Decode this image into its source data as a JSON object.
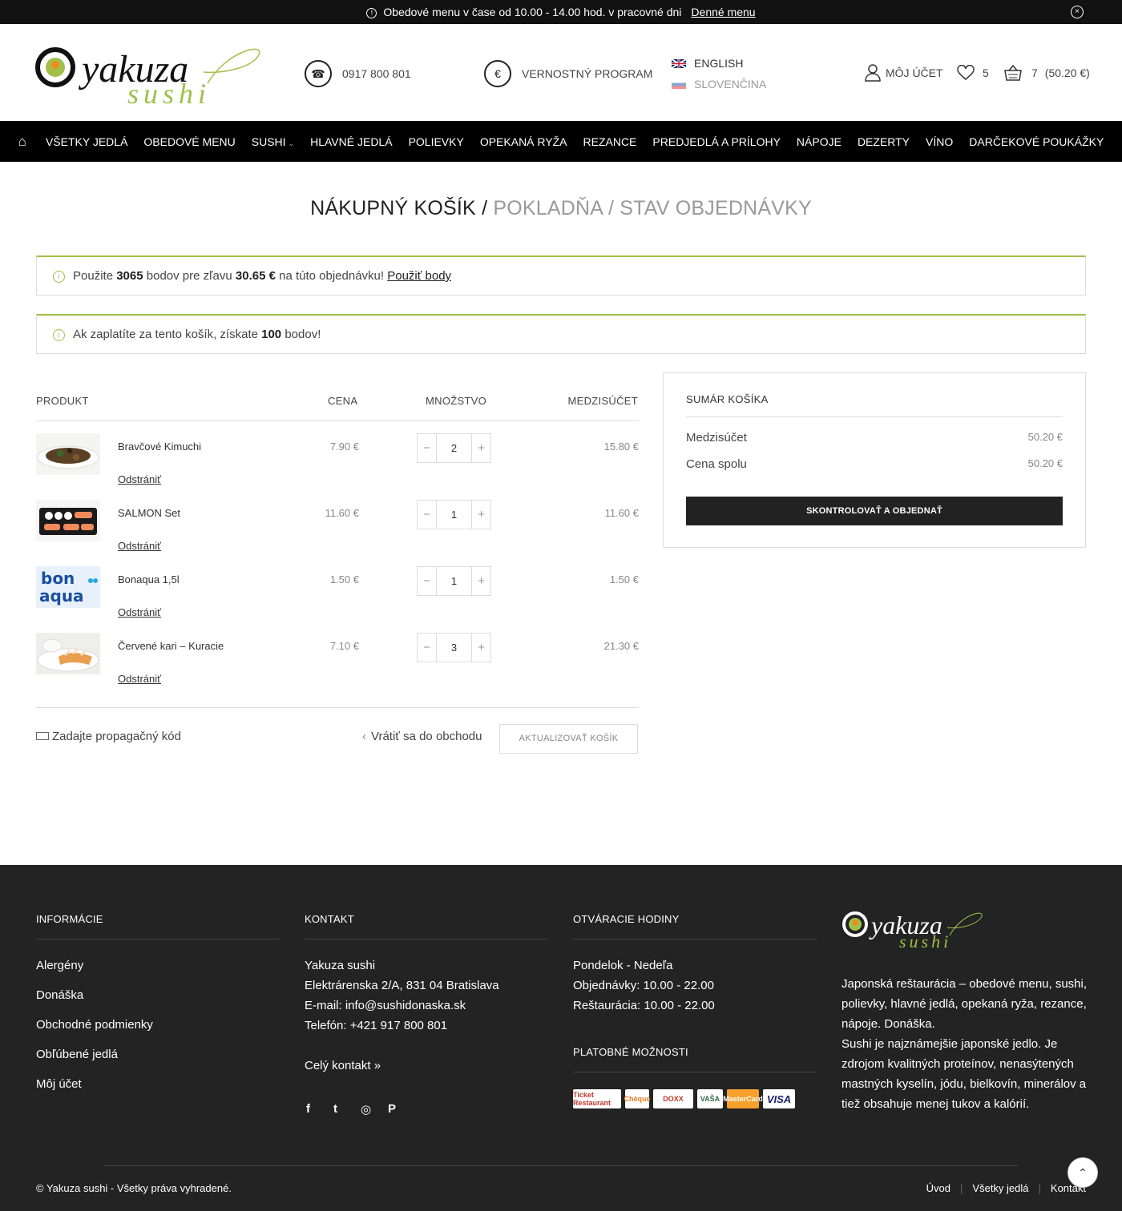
{
  "topbar": {
    "message": "Obedové menu v čase od 10.00 - 14.00 hod. v pracovné dni",
    "link": "Denné menu",
    "close": "×",
    "info_glyph": "!"
  },
  "header": {
    "logo_text": "yakuza",
    "logo_sub": "sushi",
    "phone": "0917 800 801",
    "loyalty": "VERNOSTNÝ PROGRAM",
    "languages": [
      "ENGLISH",
      "SLOVENČINA"
    ],
    "account": "MÔJ ÚČET",
    "wishlist_count": "5",
    "cart_count": "7",
    "cart_total": "(50.20 €)"
  },
  "nav": {
    "home_icon": "⌂",
    "items": [
      "VŠETKY JEDLÁ",
      "OBEDOVÉ MENU",
      "SUSHI",
      "HLAVNÉ JEDLÁ",
      "POLIEVKY",
      "OPEKANÁ RYŽA",
      "REZANCE",
      "PREDJEDLÁ A PRÍLOHY",
      "NÁPOJE",
      "DEZERTY",
      "VÍNO",
      "DARČEKOVÉ POUKÁŽKY"
    ]
  },
  "breadcrumb": {
    "current": "NÁKUPNÝ KOŠÍK",
    "sep": "/",
    "step2": "POKLADŇA",
    "step3": "STAV OBJEDNÁVKY"
  },
  "notice1": {
    "t1": "Použite",
    "points": "3065",
    "t2": "bodov pre zľavu",
    "amount": "30.65 €",
    "t3": "na túto objednávku!",
    "link": "Použiť body"
  },
  "notice2": {
    "t1": "Ak zaplatíte za tento košík, získate",
    "points": "100",
    "t2": "bodov!"
  },
  "cart": {
    "headers": {
      "product": "PRODUKT",
      "price": "CENA",
      "qty": "MNOŽSTVO",
      "subtotal": "MEDZISÚČET"
    },
    "remove_label": "Odstrániť",
    "rows": [
      {
        "name": "Bravčové Kimuchi",
        "price": "7.90 €",
        "qty": "2",
        "subtotal": "15.80 €"
      },
      {
        "name": "SALMON Set",
        "price": "11.60 €",
        "qty": "1",
        "subtotal": "11.60 €"
      },
      {
        "name": "Bonaqua 1,5l",
        "price": "1.50 €",
        "qty": "1",
        "subtotal": "1.50 €"
      },
      {
        "name": "Červené kari – Kuracie",
        "price": "7.10 €",
        "qty": "3",
        "subtotal": "21.30 €"
      }
    ],
    "promo": "Zadajte propagačný kód",
    "back": "Vrátiť sa do obchodu",
    "update": "AKTUALIZOVAŤ KOŠÍK",
    "bonaqua_label_1": "bon",
    "bonaqua_label_2": "aqua"
  },
  "summary": {
    "title": "SUMÁR KOŠÍKA",
    "subtotal_label": "Medzisúčet",
    "subtotal": "50.20 €",
    "total_label": "Cena spolu",
    "total": "50.20 €",
    "checkout": "SKONTROLOVAŤ A OBJEDNAŤ"
  },
  "footer": {
    "info_title": "INFORMÁCIE",
    "info_links": [
      "Alergény",
      "Donáška",
      "Obchodné podmienky",
      "Obľúbené jedlá",
      "Môj účet"
    ],
    "contact_title": "KONTAKT",
    "contact_lines": [
      "Yakuza sushi",
      "Elektrárenska 2/A, 831 04 Bratislava",
      "E-mail: info@sushidonaska.sk",
      "Telefón: +421 917 800 801"
    ],
    "contact_more": "Celý kontakt »",
    "hours_title": "OTVÁRACIE HODINY",
    "hours_lines": [
      "Pondelok - Nedeľa",
      "Objednávky: 10.00 - 22.00",
      "Reštaurácia: 10.00 - 22.00"
    ],
    "payment_title": "PLATOBNÉ MOŽNOSTI",
    "payments": [
      "Ticket Restaurant",
      "Chèque",
      "DOXX",
      "VAŠA",
      "MasterCard",
      "VISA"
    ],
    "about": "Japonská reštaurácia – obedové menu, sushi, polievky, hlavné jedlá, opekaná ryža, rezance, nápoje. Donáška.",
    "about2": "Sushi je najznámejšie japonské jedlo. Je zdrojom kvalitných proteínov, nenasýtených mastných kyselín, jódu, bielkovín, minerálov a tiež obsahuje menej tukov a kalórií.",
    "copyright": "© Yakuza sushi - Všetky práva vyhradené.",
    "bottom_links": [
      "Úvod",
      "Všetky jedlá",
      "Kontakt"
    ],
    "social": [
      "f",
      "t",
      "◎",
      "P"
    ]
  },
  "colors": {
    "accent": "#a0c04a",
    "dark": "#232323",
    "orange": "#f08a1c"
  }
}
